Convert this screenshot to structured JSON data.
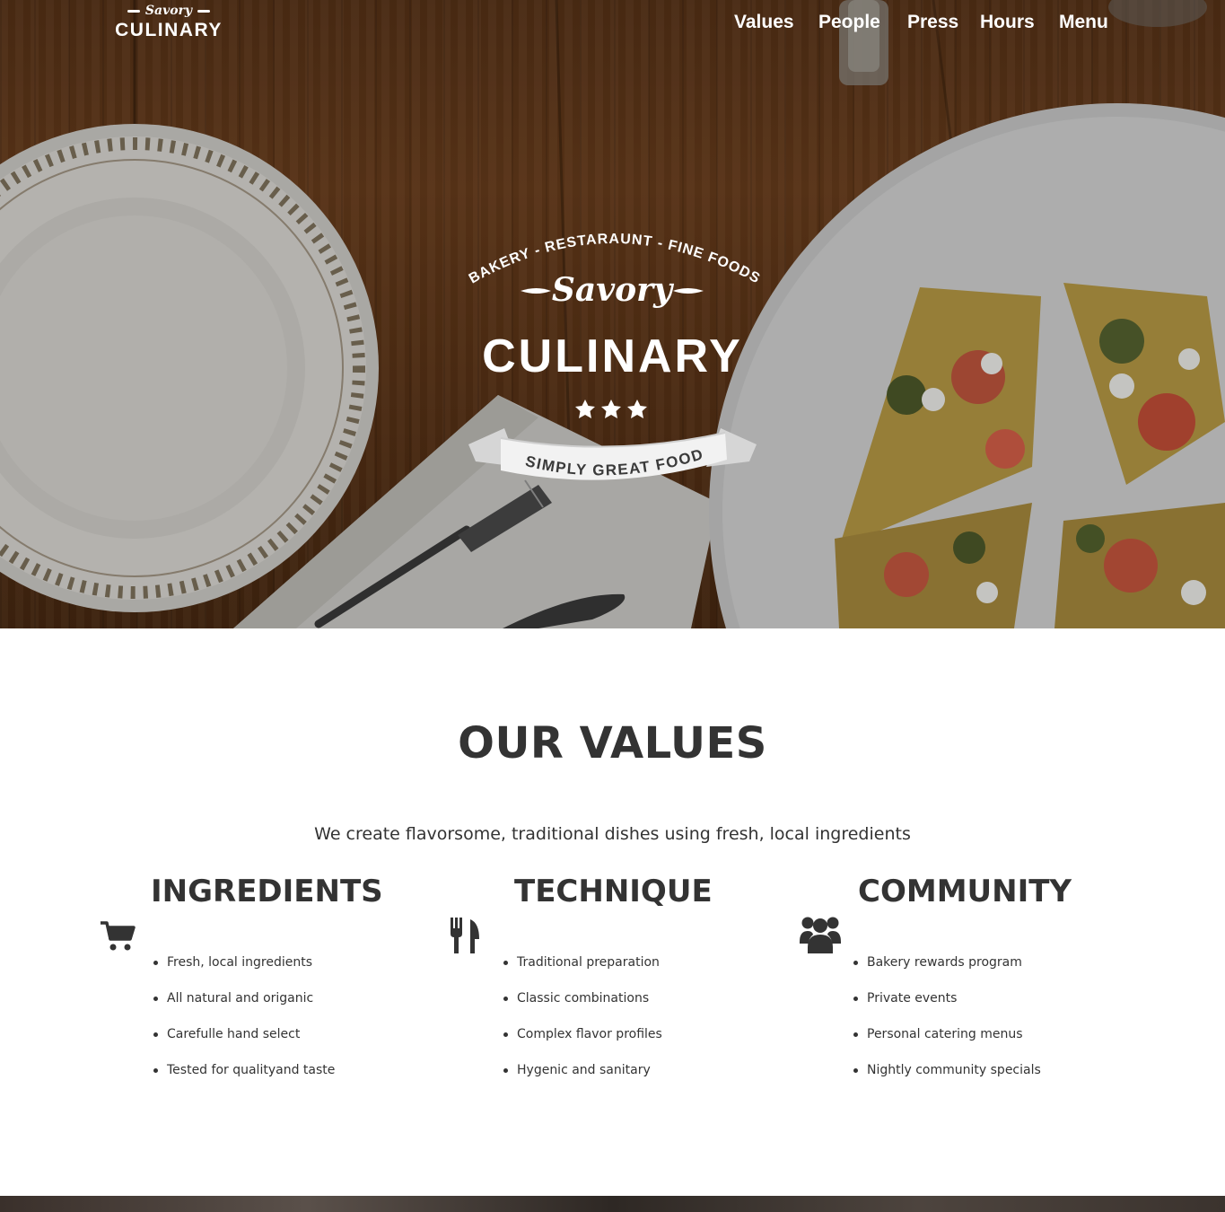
{
  "brand": {
    "script": "Savory",
    "word": "CULINARY"
  },
  "nav": {
    "items": [
      "Values",
      "People",
      "Press",
      "Hours",
      "Menu"
    ]
  },
  "hero": {
    "arc_text": "BAKERY - RESTARAUNT - FINE FOODS",
    "script": "Savory",
    "title": "CULINARY",
    "ribbon": "SIMPLY GREAT FOOD"
  },
  "values": {
    "title": "OUR VALUES",
    "subtitle": "We create flavorsome, traditional dishes using fresh, local ingredients",
    "columns": [
      {
        "heading": "INGREDIENTS",
        "icon": "cart-icon",
        "items": [
          "Fresh, local ingredients",
          "All natural and origanic",
          "Carefulle hand select",
          "Tested for qualityand taste"
        ]
      },
      {
        "heading": "TECHNIQUE",
        "icon": "fork-knife-icon",
        "items": [
          "Traditional preparation",
          "Classic combinations",
          "Complex flavor profiles",
          "Hygenic and sanitary"
        ]
      },
      {
        "heading": "COMMUNITY",
        "icon": "users-icon",
        "items": [
          "Bakery rewards program",
          "Private events",
          "Personal catering menus",
          "Nightly community specials"
        ]
      }
    ]
  },
  "colors": {
    "heading": "#333333",
    "hero_wood": "#5a3418",
    "white": "#ffffff"
  }
}
